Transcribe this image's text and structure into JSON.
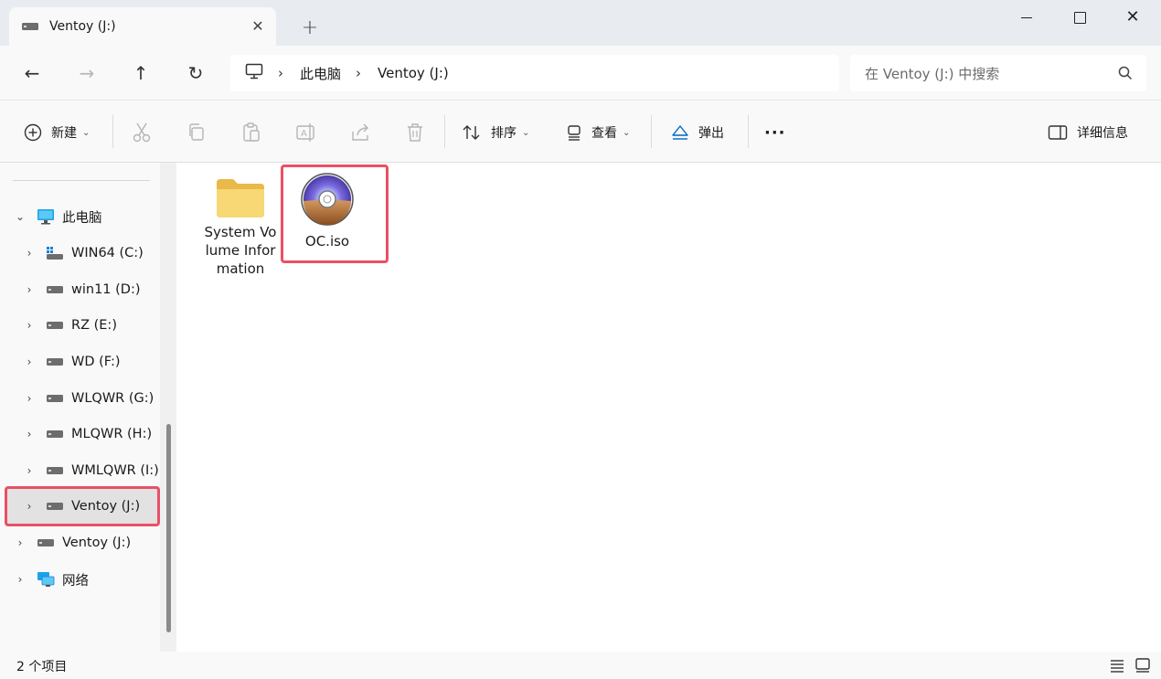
{
  "window": {
    "tab_title": "Ventoy (J:)",
    "tab_close": "✕",
    "new_tab": "+",
    "minimize": "",
    "maximize": "",
    "close": "✕"
  },
  "address": {
    "back": "←",
    "forward": "→",
    "up": "↑",
    "refresh": "↻",
    "separator": "›",
    "crumbs": [
      "此电脑",
      "Ventoy (J:)"
    ],
    "search_placeholder": "在 Ventoy (J:) 中搜索"
  },
  "toolbar": {
    "new_label": "新建",
    "sort_label": "排序",
    "view_label": "查看",
    "eject_label": "弹出",
    "more_label": "···",
    "details_label": "详细信息",
    "caret": "⌄",
    "icons": [
      "cut-icon",
      "copy-icon",
      "paste-icon",
      "rename-icon",
      "share-icon",
      "delete-icon"
    ]
  },
  "sidebar": {
    "root": {
      "label": "此电脑",
      "chevron": "⌄"
    },
    "drives": [
      {
        "label": "WIN64 (C:)"
      },
      {
        "label": "win11 (D:)"
      },
      {
        "label": "RZ (E:)"
      },
      {
        "label": "WD (F:)"
      },
      {
        "label": "WLQWR (G:)"
      },
      {
        "label": "MLQWR (H:)"
      },
      {
        "label": "WMLQWR (I:)"
      },
      {
        "label": "Ventoy (J:)"
      }
    ],
    "ventoy_top": {
      "label": "Ventoy (J:)"
    },
    "network": {
      "label": "网络"
    },
    "chevron": "›",
    "selected": "Ventoy (J:)"
  },
  "files": [
    {
      "name": "System Volume Information",
      "type": "folder"
    },
    {
      "name": "OC.iso",
      "type": "iso"
    }
  ],
  "status": {
    "item_count": "2 个项目"
  },
  "colors": {
    "highlight": "#ea5064",
    "folder": "#f6d27a",
    "accent": "#0067c0"
  }
}
